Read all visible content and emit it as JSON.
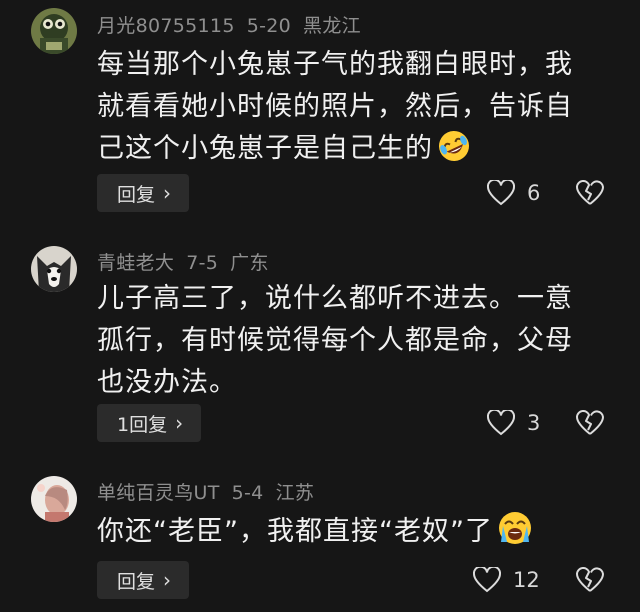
{
  "comments": [
    {
      "username": "月光80755115",
      "date": "5-20",
      "location": "黑龙江",
      "lines": [
        "每当那个小兔崽子气的我翻白眼时，我",
        "就看看她小时候的照片，然后，告诉自",
        "己这个小兔崽子是自己生的"
      ],
      "emoji": "rofl-emoji",
      "reply_label": "回复",
      "like_count": "6"
    },
    {
      "username": "青蛙老大",
      "date": "7-5",
      "location": "广东",
      "lines": [
        "儿子高三了，说什么都听不进去。一意",
        "孤行，有时候觉得每个人都是命，父母",
        "也没办法。"
      ],
      "reply_label": "1回复",
      "like_count": "3"
    },
    {
      "username": "单纯百灵鸟UT",
      "date": "5-4",
      "location": "江苏",
      "lines": [
        "你还“老臣”，我都直接“老奴”了"
      ],
      "emoji": "crying-laughing-emoji",
      "reply_label": "回复",
      "like_count": "12"
    }
  ],
  "colors": {
    "background": "#161616",
    "meta_text": "#8f8f8f",
    "button_bg": "#2b2b2b"
  }
}
